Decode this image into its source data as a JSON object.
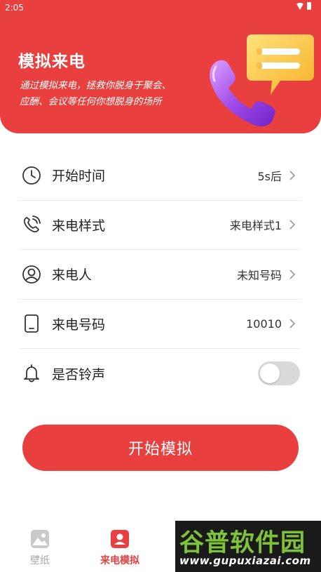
{
  "status_bar": {
    "time": "2:05"
  },
  "hero": {
    "title": "模拟来电",
    "description_line1": "通过模拟来电，拯救你脱身于聚会、",
    "description_line2": "应酬、会议等任何你想脱身的场所"
  },
  "settings": [
    {
      "label": "开始时间",
      "value": "5s后",
      "icon": "clock-icon"
    },
    {
      "label": "来电样式",
      "value": "来电样式1",
      "icon": "phone-ringing-icon"
    },
    {
      "label": "来电人",
      "value": "未知号码",
      "icon": "person-icon"
    },
    {
      "label": "来电号码",
      "value": "10010",
      "icon": "mobile-icon"
    },
    {
      "label": "是否铃声",
      "toggle_on": false,
      "icon": "bell-icon"
    }
  ],
  "start_button": {
    "label": "开始模拟"
  },
  "bottom_nav": [
    {
      "label": "壁纸",
      "active": false,
      "icon": "image-icon"
    },
    {
      "label": "来电模拟",
      "active": true,
      "icon": "contact-icon"
    }
  ],
  "watermark": {
    "name": "谷普软件园",
    "url": "www.gupuxiazai.com"
  },
  "colors": {
    "accent": "#e9403f",
    "toggle_off": "#d9d9d9"
  }
}
